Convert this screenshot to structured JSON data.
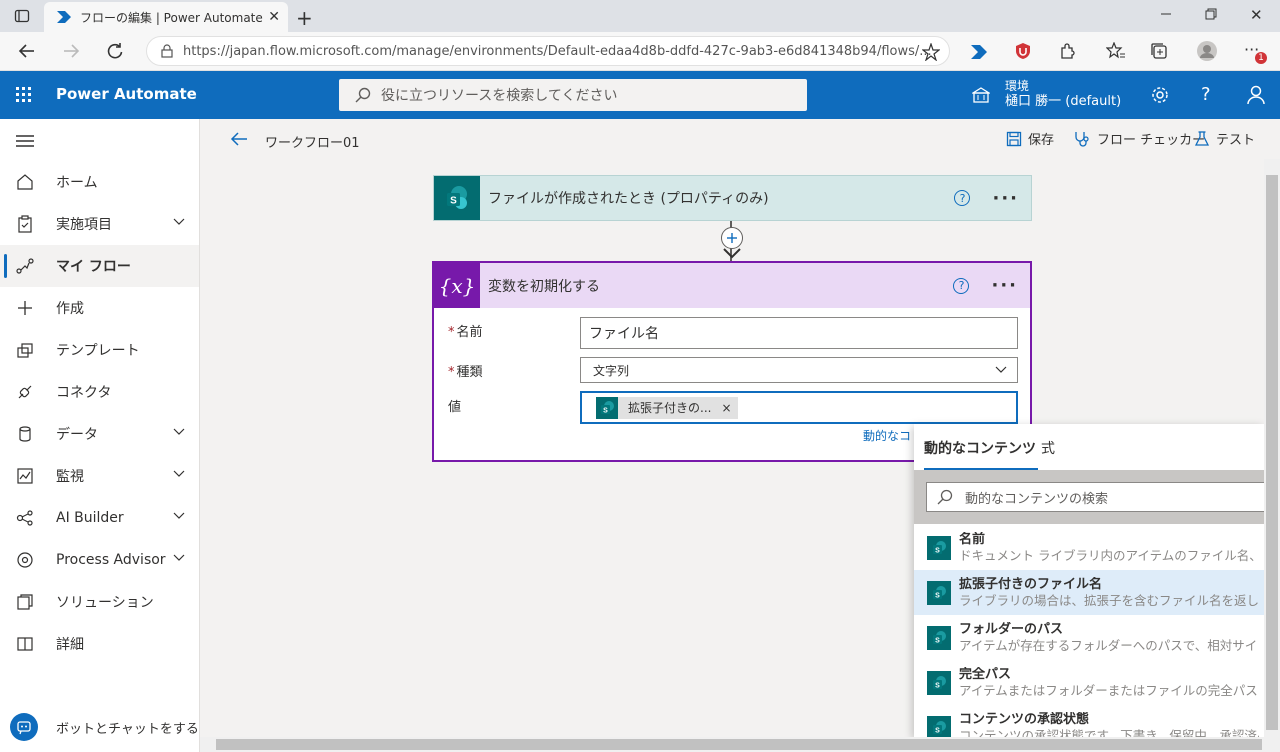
{
  "browser": {
    "tab_title": "フローの編集 | Power Automate",
    "url": "https://japan.flow.microsoft.com/manage/environments/Default-edaa4d8b-ddfd-427c-9ab3-e6d841348b94/flows/...",
    "notification_badge": "1"
  },
  "header": {
    "brand": "Power Automate",
    "search_placeholder": "役に立つリソースを検索してください",
    "env_label": "環境",
    "env_name": "樋口 勝一 (default)"
  },
  "nav": {
    "items": [
      {
        "label": "ホーム",
        "icon": "home-icon"
      },
      {
        "label": "実施項目",
        "icon": "clipboard-icon"
      },
      {
        "label": "マイ フロー",
        "icon": "flow-icon"
      },
      {
        "label": "作成",
        "icon": "plus-icon"
      },
      {
        "label": "テンプレート",
        "icon": "template-icon"
      },
      {
        "label": "コネクタ",
        "icon": "connector-icon"
      },
      {
        "label": "データ",
        "icon": "database-icon"
      },
      {
        "label": "監視",
        "icon": "monitor-icon"
      },
      {
        "label": "AI Builder",
        "icon": "ai-builder-icon"
      },
      {
        "label": "Process Advisor",
        "icon": "process-advisor-icon"
      },
      {
        "label": "ソリューション",
        "icon": "solution-icon"
      },
      {
        "label": "詳細",
        "icon": "book-icon"
      }
    ],
    "bot_chat": "ボットとチャットをする"
  },
  "commands": {
    "flow_name": "ワークフロー01",
    "save": "保存",
    "checker": "フロー チェッカー",
    "test": "テスト"
  },
  "trigger": {
    "title": "ファイルが作成されたとき (プロパティのみ)",
    "help": "?",
    "more": "···"
  },
  "action": {
    "title": "変数を初期化する",
    "icon_text": "{x}",
    "help": "?",
    "more": "···",
    "fields": {
      "name_label": "名前",
      "name_value": "ファイル名",
      "type_label": "種類",
      "type_value": "文字列",
      "value_label": "値",
      "token_label": "拡張子付きの...",
      "token_remove": "×",
      "required_mark": "*"
    },
    "dynamic_link": "動的なコ"
  },
  "dynamic_panel": {
    "tab_dynamic": "動的なコンテンツ",
    "tab_expression": "式",
    "search_placeholder": "動的なコンテンツの検索",
    "items": [
      {
        "name": "名前",
        "desc": "ドキュメント ライブラリ内のアイテムのファイル名、リ"
      },
      {
        "name": "拡張子付きのファイル名",
        "desc": "ライブラリの場合は、拡張子を含むファイル名を返しま..."
      },
      {
        "name": "フォルダーのパス",
        "desc": "アイテムが存在するフォルダーへのパスで、相対サイト"
      },
      {
        "name": "完全パス",
        "desc": "アイテムまたはフォルダーまたはファイルの完全パス"
      },
      {
        "name": "コンテンツの承認状態",
        "desc": "コンテンツの承認状態です。下書き、保留中、承認済み"
      }
    ]
  }
}
